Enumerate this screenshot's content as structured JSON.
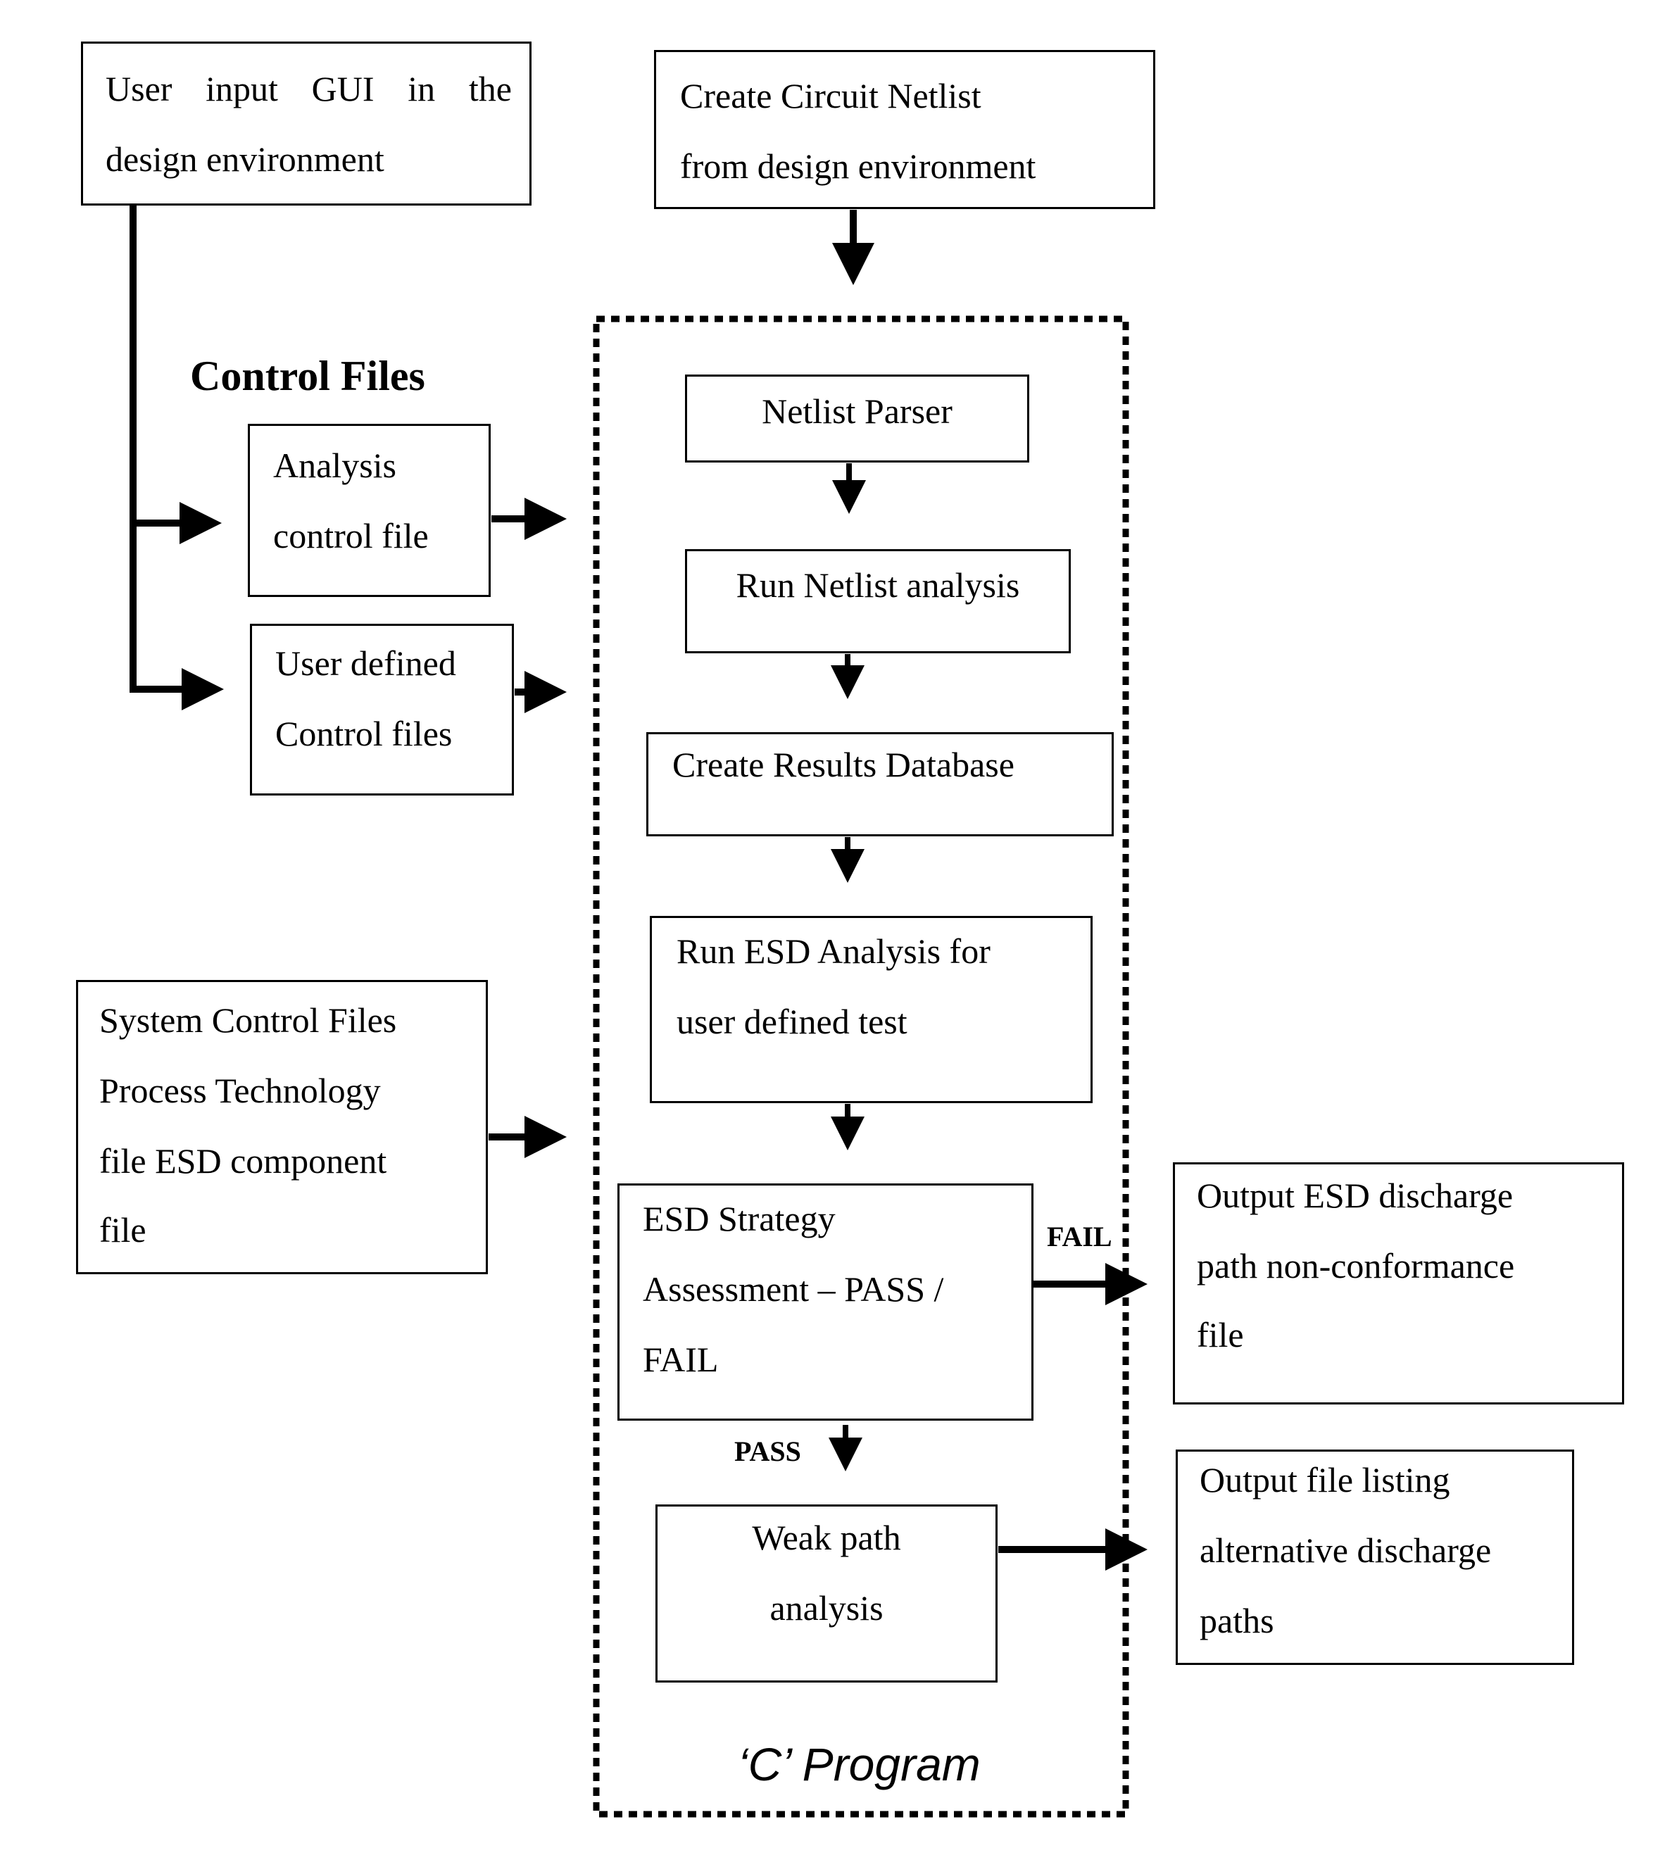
{
  "diagram": {
    "boxes": {
      "user_input_gui": [
        "User input GUI in the",
        "design environment"
      ],
      "create_netlist": [
        "Create Circuit Netlist",
        "from design environment"
      ],
      "analysis_control": [
        "Analysis",
        "control file"
      ],
      "user_defined_control": [
        "User defined",
        "Control files"
      ],
      "system_control": [
        "System Control Files",
        "Process Technology",
        "file ESD component",
        "file"
      ],
      "netlist_parser": [
        "Netlist Parser"
      ],
      "run_netlist_analysis": [
        "Run Netlist analysis"
      ],
      "create_results_db": [
        "Create Results Database"
      ],
      "run_esd_analysis": [
        "Run ESD Analysis for",
        "user defined test"
      ],
      "esd_strategy": [
        "ESD Strategy",
        "Assessment – PASS /",
        "FAIL"
      ],
      "weak_path": [
        "Weak path",
        "analysis"
      ],
      "output_nonconformance": [
        "Output ESD discharge",
        "path non-conformance",
        "file"
      ],
      "output_alternative": [
        "Output file listing",
        "alternative discharge",
        "paths"
      ]
    },
    "labels": {
      "control_files_heading": "Control Files",
      "fail": "FAIL",
      "pass": "PASS",
      "c_program": "‘C’ Program"
    },
    "edges": [
      {
        "from": "create_netlist",
        "to": "c_program_container"
      },
      {
        "from": "user_input_gui",
        "to": "analysis_control"
      },
      {
        "from": "user_input_gui",
        "to": "user_defined_control"
      },
      {
        "from": "analysis_control",
        "to": "c_program_container"
      },
      {
        "from": "user_defined_control",
        "to": "c_program_container"
      },
      {
        "from": "system_control",
        "to": "c_program_container"
      },
      {
        "from": "netlist_parser",
        "to": "run_netlist_analysis"
      },
      {
        "from": "run_netlist_analysis",
        "to": "create_results_db"
      },
      {
        "from": "create_results_db",
        "to": "run_esd_analysis"
      },
      {
        "from": "run_esd_analysis",
        "to": "esd_strategy"
      },
      {
        "from": "esd_strategy",
        "to": "weak_path",
        "label": "PASS"
      },
      {
        "from": "esd_strategy",
        "to": "output_nonconformance",
        "label": "FAIL"
      },
      {
        "from": "weak_path",
        "to": "output_alternative"
      }
    ]
  }
}
